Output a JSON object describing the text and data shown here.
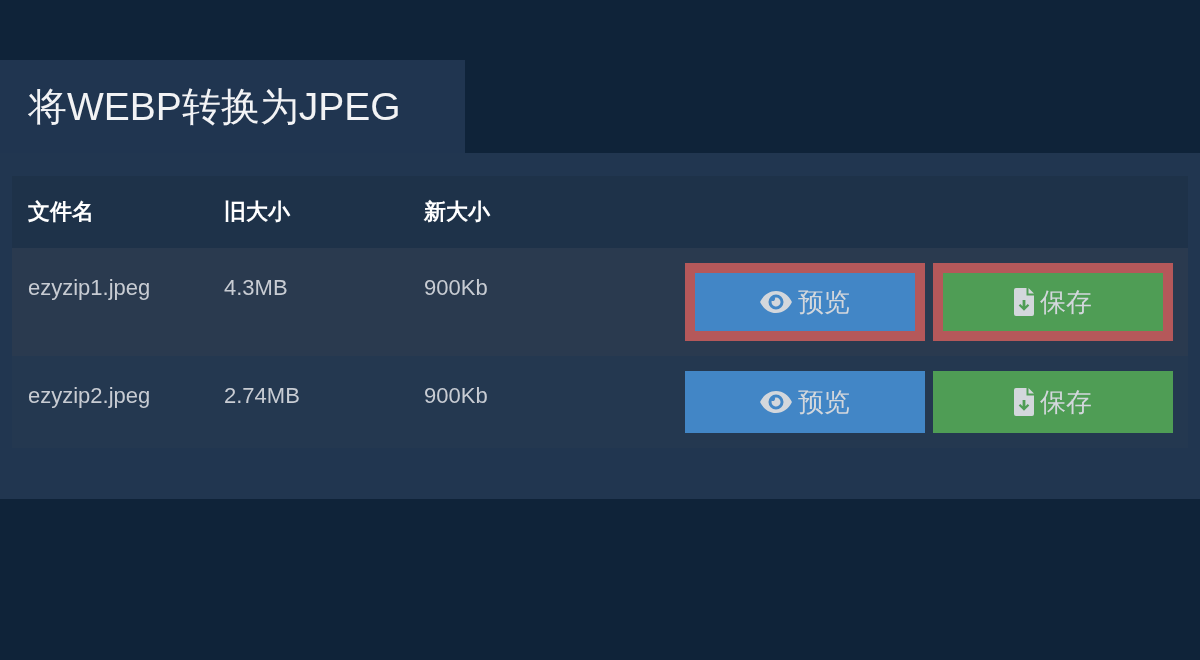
{
  "title": "将WEBP转换为JPEG",
  "table": {
    "columns": [
      "文件名",
      "旧大小",
      "新大小"
    ],
    "rows": [
      {
        "file_name": "ezyzip1.jpeg",
        "old_size": "4.3MB",
        "new_size": "900Kb",
        "actions": [
          {
            "kind": "preview",
            "label": "预览",
            "outlined": true
          },
          {
            "kind": "save",
            "label": "保存",
            "outlined": true
          }
        ]
      },
      {
        "file_name": "ezyzip2.jpeg",
        "old_size": "2.74MB",
        "new_size": "900Kb",
        "actions": [
          {
            "kind": "preview",
            "label": "预览",
            "outlined": false
          },
          {
            "kind": "save",
            "label": "保存",
            "outlined": false
          }
        ]
      }
    ]
  }
}
